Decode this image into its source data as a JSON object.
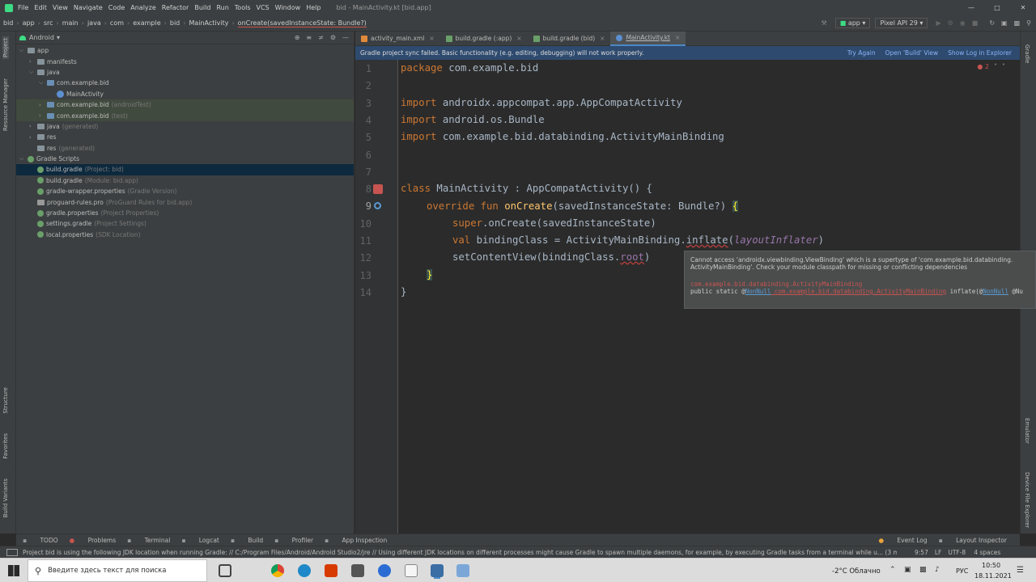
{
  "window": {
    "title": "bid - MainActivity.kt [bid.app]"
  },
  "menu": [
    "File",
    "Edit",
    "View",
    "Navigate",
    "Code",
    "Analyze",
    "Refactor",
    "Build",
    "Run",
    "Tools",
    "VCS",
    "Window",
    "Help"
  ],
  "breadcrumbs": [
    "bid",
    "app",
    "src",
    "main",
    "java",
    "com",
    "example",
    "bid",
    "MainActivity",
    "onCreate(savedInstanceState: Bundle?)"
  ],
  "run_config": {
    "module": "app",
    "device": "Pixel API 29"
  },
  "project_panel": {
    "view": "Android",
    "tree": [
      {
        "label": "app",
        "ann": ""
      },
      {
        "label": "manifests",
        "ann": ""
      },
      {
        "label": "java",
        "ann": ""
      },
      {
        "label": "com.example.bid",
        "ann": ""
      },
      {
        "label": "MainActivity",
        "ann": ""
      },
      {
        "label": "com.example.bid",
        "ann": "(androidTest)"
      },
      {
        "label": "com.example.bid",
        "ann": "(test)"
      },
      {
        "label": "java",
        "ann": "(generated)"
      },
      {
        "label": "res",
        "ann": ""
      },
      {
        "label": "res",
        "ann": "(generated)"
      },
      {
        "label": "Gradle Scripts",
        "ann": ""
      },
      {
        "label": "build.gradle",
        "ann": "(Project: bid)"
      },
      {
        "label": "build.gradle",
        "ann": "(Module: bid.app)"
      },
      {
        "label": "gradle-wrapper.properties",
        "ann": "(Gradle Version)"
      },
      {
        "label": "proguard-rules.pro",
        "ann": "(ProGuard Rules for bid.app)"
      },
      {
        "label": "gradle.properties",
        "ann": "(Project Properties)"
      },
      {
        "label": "settings.gradle",
        "ann": "(Project Settings)"
      },
      {
        "label": "local.properties",
        "ann": "(SDK Location)"
      }
    ]
  },
  "left_strip": {
    "project": "Project",
    "resource_manager": "Resource Manager",
    "structure": "Structure",
    "favorites": "Favorites",
    "build_variants": "Build Variants"
  },
  "right_strip": {
    "gradle": "Gradle",
    "emulator": "Emulator",
    "device_explorer": "Device File Explorer"
  },
  "editor_tabs": [
    "activity_main.xml",
    "build.gradle (:app)",
    "build.gradle (bid)",
    "MainActivity.kt"
  ],
  "banner": {
    "message": "Gradle project sync failed. Basic functionality (e.g. editing, debugging) will not work properly.",
    "try_again": "Try Again",
    "open_build": "Open 'Build' View",
    "show_log": "Show Log in Explorer"
  },
  "problems_count": "2",
  "line_numbers": [
    "1",
    "2",
    "3",
    "4",
    "5",
    "6",
    "7",
    "8",
    "9",
    "10",
    "11",
    "12",
    "13",
    "14"
  ],
  "code": {
    "l1_kw": "package",
    "l1_rest": " com.example.bid",
    "l3_kw": "import",
    "l3_rest": " androidx.appcompat.app.AppCompatActivity",
    "l4_kw": "import",
    "l4_rest": " android.os.Bundle",
    "l5_kw": "import",
    "l5_rest": " com.example.bid.databinding.ActivityMainBinding",
    "l8_kw": "class",
    "l8_rest": " MainActivity : AppCompatActivity() {",
    "l9_kw": "override fun ",
    "l9_fn": "onCreate",
    "l9_rest": "(savedInstanceState: Bundle?) ",
    "l9_brace": "{",
    "l10_kw": "super",
    "l10_rest": ".onCreate(savedInstanceState)",
    "l11_kw": "val",
    "l11_mid": " bindingClass = ActivityMainBinding.",
    "l11_err": "inflate",
    "l11_p1": "(",
    "l11_it": "layoutInflater",
    "l11_p2": ")",
    "l12_a": "setContentView(bindingClass.",
    "l12_err": "root",
    "l12_b": ")",
    "l13": "}",
    "l14": "}"
  },
  "tooltip": {
    "line1": "Cannot access 'androidx.viewbinding.ViewBinding' which is a supertype of 'com.example.bid.databinding.",
    "line2": "ActivityMainBinding'. Check your module classpath for missing or conflicting dependencies",
    "line3": "com.example.bid.databinding.ActivityMainBinding",
    "l4_a": "public static @",
    "l4_b": "NonNull",
    "l4_c": " com.example.bid.databinding.ActivityMainBinding",
    "l4_d": " inflate(@",
    "l4_e": "NonNull",
    "l4_f": " @Nu"
  },
  "tool_windows": [
    "TODO",
    "Problems",
    "Terminal",
    "Logcat",
    "Build",
    "Profiler",
    "App Inspection"
  ],
  "tool_windows_right": [
    "Event Log",
    "Layout Inspector"
  ],
  "status": {
    "message": "Project bid is using the following JDK location when running Gradle: // C:/Program Files/Android/Android Studio2/jre // Using different JDK locations on different processes might cause Gradle to spawn multiple daemons, for example, by executing Gradle tasks from a terminal while u... (3 minutes ago)",
    "position": "9:57",
    "line_sep": "LF",
    "encoding": "UTF-8",
    "indent": "4 spaces"
  },
  "taskbar": {
    "search_placeholder": "Введите здесь текст для поиска",
    "weather": "-2°C  Облачно",
    "lang": "РУС",
    "time": "10:50",
    "date": "18.11.2021"
  }
}
